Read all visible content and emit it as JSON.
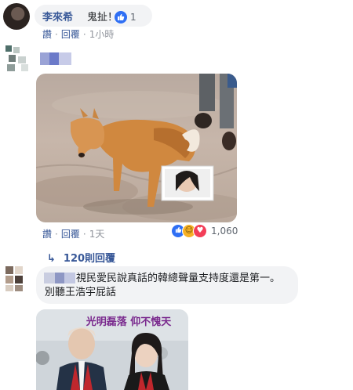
{
  "comments": [
    {
      "author": "李來希",
      "text": "鬼扯！",
      "reaction_count": "1",
      "actions": {
        "like": "讚",
        "reply": "回覆",
        "time": "1小時"
      }
    },
    {
      "author": "",
      "image_label": "photo-dog",
      "actions": {
        "like": "讚",
        "reply": "回覆",
        "time": "1天"
      },
      "reaction_count": "1,060",
      "reactions": [
        "like-icon",
        "haha-icon",
        "love-icon"
      ],
      "replies_label": "120則回覆"
    },
    {
      "author": "",
      "text": "視民愛民說真話的韓總聲量支持度還是第一。別聽王浩宇屁話",
      "image_caption": "光明磊落  仰不愧天"
    }
  ],
  "colors": {
    "link": "#385898",
    "bubble": "#f2f3f5",
    "like": "#2f6ff4",
    "haha": "#f7b125",
    "love": "#f33e58",
    "caption": "#7a2a8e"
  }
}
